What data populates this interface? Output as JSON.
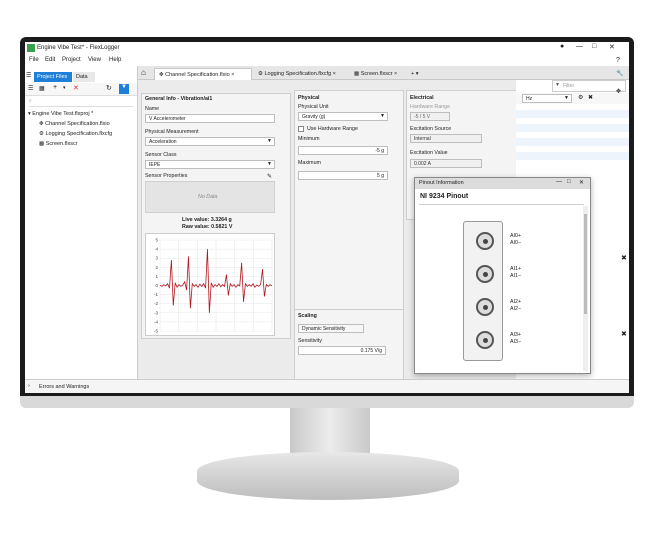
{
  "app": {
    "title": "Engine Vibe Test* - FlexLogger",
    "menu": [
      "File",
      "Edit",
      "Project",
      "View",
      "Help"
    ]
  },
  "left_panel": {
    "tabs": [
      "Project Files",
      "Data"
    ],
    "tree": {
      "root": "Engine Vibe Test.flxproj *",
      "children": [
        "Channel Specification.flxio",
        "Logging Specification.flxcfg",
        "Screen.flxscr"
      ]
    },
    "errors_label": "Errors and Warnings"
  },
  "doc_tabs": [
    "Channel Specification.flxio",
    "Logging Specification.flxcfg",
    "Screen.flxscr"
  ],
  "general": {
    "header": "General Info - Vibration/ai1",
    "name_label": "Name",
    "name_value": "V Accelerometer",
    "phys_meas_label": "Physical Measurement",
    "phys_meas_value": "Acceleration",
    "sensor_class_label": "Sensor Class",
    "sensor_class_value": "IEPE",
    "sensor_props_label": "Sensor Properties",
    "no_data": "No Data",
    "live_value": "Live value: 3.3264 g",
    "raw_value": "Raw value: 0.5821 V"
  },
  "physical": {
    "header": "Physical",
    "unit_label": "Physical Unit",
    "unit_value": "Gravity (g)",
    "hw_range_label": "Use Hardware Range",
    "min_label": "Minimum",
    "min_value": "-5 g",
    "max_label": "Maximum",
    "max_value": "5 g"
  },
  "scaling": {
    "header": "Scaling",
    "type_value": "Dynamic Sensitivity",
    "sens_label": "Sensitivity",
    "sens_value": "0.175 V/g"
  },
  "electrical": {
    "header": "Electrical",
    "hw_range_label": "Hardware Range",
    "hw_range_value": "-5 / 5 V",
    "exc_source_label": "Excitation Source",
    "exc_source_value": "Internal",
    "exc_value_label": "Excitation Value",
    "exc_value_value": "0.002 A"
  },
  "pinout": {
    "window_title": "Pinout Information",
    "heading": "NI 9234 Pinout",
    "pins": [
      [
        "AI0+",
        "AI0−"
      ],
      [
        "AI1+",
        "AI1−"
      ],
      [
        "AI2+",
        "AI2−"
      ],
      [
        "AI3+",
        "AI3−"
      ]
    ]
  },
  "right": {
    "filter_placeholder": "Filter",
    "rate_value": "Hz"
  },
  "chart_data": {
    "type": "line",
    "y_ticks": [
      "5",
      "4",
      "3",
      "2",
      "1",
      "0",
      "-1",
      "-2",
      "-3",
      "-4",
      "-5"
    ],
    "ylim": [
      -5,
      5
    ],
    "series": [
      {
        "values": [
          0.05,
          -0.1,
          0.1,
          -0.05,
          0.2,
          -0.3,
          2.8,
          -2.2,
          0.3,
          -0.2,
          0.1,
          -0.1,
          0.05,
          0.4,
          -0.5,
          3.2,
          -2.5,
          0.2,
          -0.1,
          0.1,
          -0.2,
          0.15,
          -0.1,
          0.2,
          -0.3,
          4.0,
          -3.0,
          0.3,
          -0.2,
          0.1,
          -0.1,
          0.2,
          -0.15,
          0.1,
          -0.1,
          1.2,
          -1.1,
          0.2,
          -0.1,
          0.1,
          -0.2,
          0.1,
          -0.05,
          2.5,
          -1.8,
          0.2,
          -0.1,
          0.1,
          -0.1,
          0.2,
          -0.2,
          0.05,
          -0.1,
          0.1,
          1.8,
          -1.2,
          0.1,
          -0.1,
          0.1,
          -0.05
        ]
      }
    ],
    "color": "#b01820"
  },
  "colors": {
    "accent": "#1e7fd8",
    "trace": "#b01820"
  }
}
